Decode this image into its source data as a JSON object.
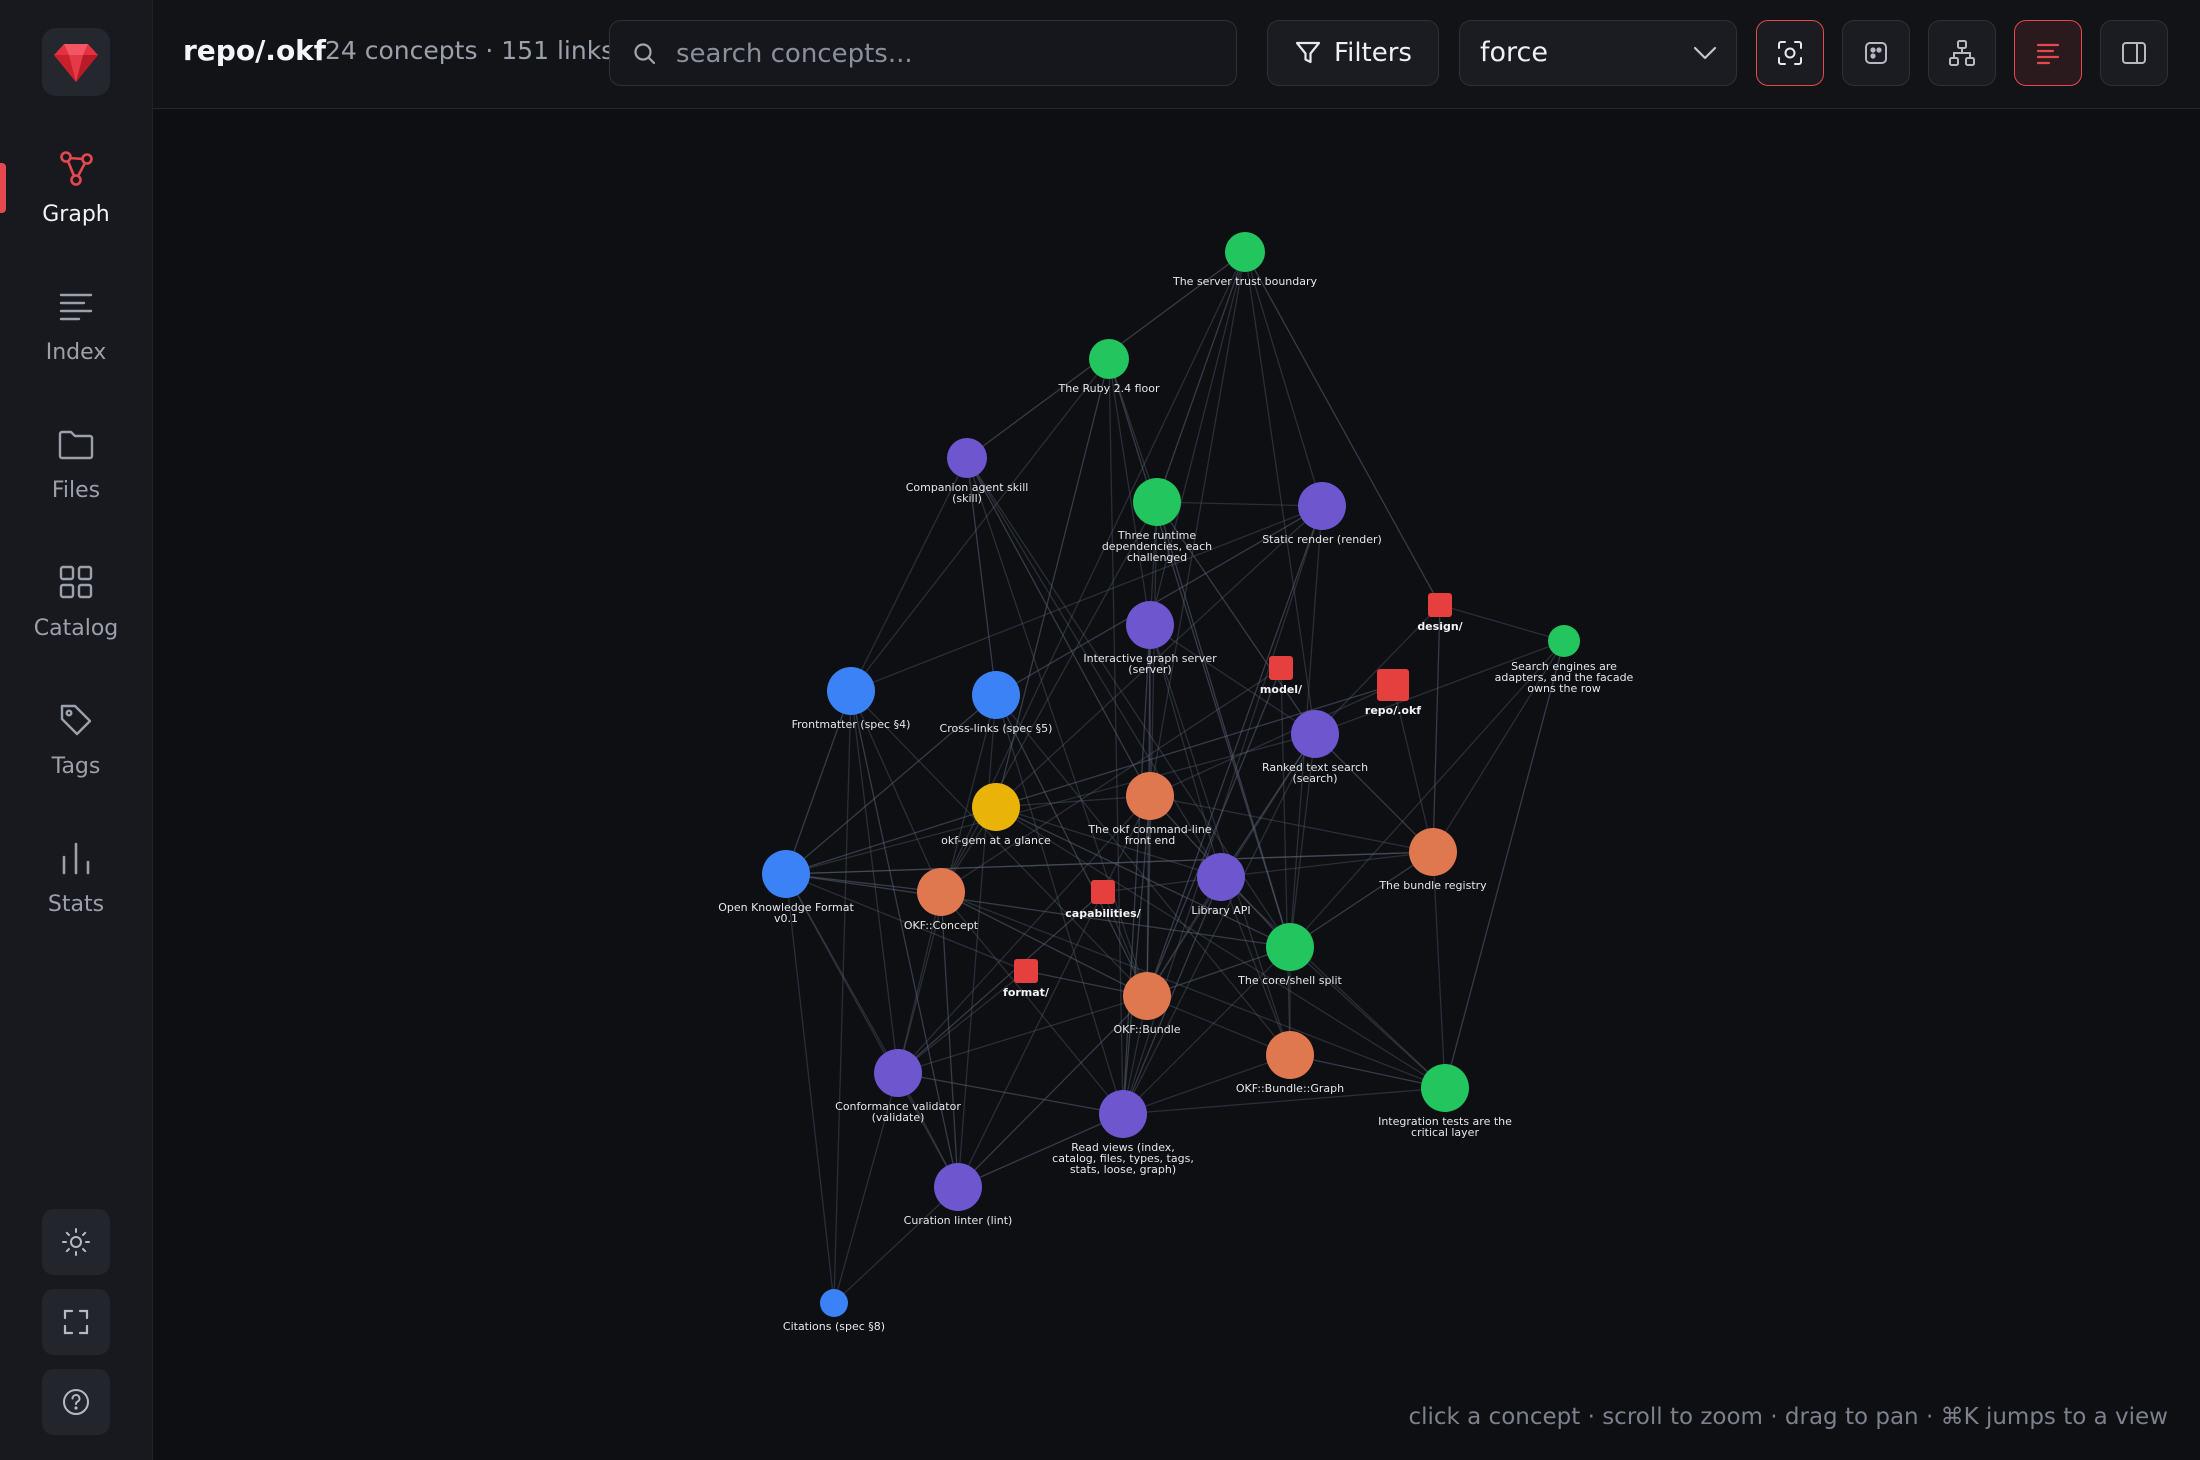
{
  "sidebar": {
    "items": [
      {
        "label": "Graph",
        "icon": "graph-icon",
        "active": true
      },
      {
        "label": "Index",
        "icon": "list-icon"
      },
      {
        "label": "Files",
        "icon": "folder-icon"
      },
      {
        "label": "Catalog",
        "icon": "grid-icon"
      },
      {
        "label": "Tags",
        "icon": "tag-icon"
      },
      {
        "label": "Stats",
        "icon": "bar-chart-icon"
      }
    ],
    "bottom": [
      "sun-icon",
      "fullscreen-icon",
      "help-icon"
    ]
  },
  "header": {
    "title": "repo/.okf",
    "meta": "24 concepts · 151 links",
    "search_placeholder": "search concepts...",
    "filters_label": "Filters",
    "layout_value": "force",
    "toolbar_icons": [
      "focus-icon",
      "cluster-icon",
      "hierarchy-icon",
      "labels-icon",
      "panel-icon"
    ]
  },
  "hint": "click a concept · scroll to zoom · drag to pan · ⌘K jumps to a view",
  "colors": {
    "accent": "#e5484d",
    "blue": "#3b82f6",
    "purple": "#6e56cf",
    "green": "#22c55e",
    "orange": "#e0784f",
    "yellow": "#eab308",
    "red": "#e5403e"
  },
  "graph": {
    "nodes": [
      {
        "id": "server-trust",
        "lines": [
          "The server trust boundary"
        ],
        "color": "green"
      },
      {
        "id": "ruby",
        "lines": [
          "The Ruby 2.4 floor"
        ],
        "color": "green"
      },
      {
        "id": "companion",
        "lines": [
          "Companion agent skill",
          "(skill)"
        ],
        "color": "purple"
      },
      {
        "id": "three-deps",
        "lines": [
          "Three runtime",
          "dependencies, each",
          "challenged"
        ],
        "color": "green"
      },
      {
        "id": "static-render",
        "lines": [
          "Static render (render)"
        ],
        "color": "purple"
      },
      {
        "id": "design",
        "lines": [
          "design/"
        ],
        "color": "red",
        "dir": true
      },
      {
        "id": "search-engines",
        "lines": [
          "Search engines are",
          "adapters, and the facade",
          "owns the row"
        ],
        "color": "green"
      },
      {
        "id": "interactive",
        "lines": [
          "Interactive graph server",
          "(server)"
        ],
        "color": "purple"
      },
      {
        "id": "model",
        "lines": [
          "model/"
        ],
        "color": "red",
        "dir": true
      },
      {
        "id": "repo-okf",
        "lines": [
          "repo/.okf"
        ],
        "color": "red",
        "dir": true
      },
      {
        "id": "frontmatter",
        "lines": [
          "Frontmatter (spec §4)"
        ],
        "color": "blue"
      },
      {
        "id": "crosslinks",
        "lines": [
          "Cross-links (spec §5)"
        ],
        "color": "blue"
      },
      {
        "id": "ranked-search",
        "lines": [
          "Ranked text search",
          "(search)"
        ],
        "color": "purple"
      },
      {
        "id": "okf-gem",
        "lines": [
          "okf-gem at a glance"
        ],
        "color": "yellow"
      },
      {
        "id": "cli",
        "lines": [
          "The okf command-line",
          "front end"
        ],
        "color": "orange"
      },
      {
        "id": "bundle-registry",
        "lines": [
          "The bundle registry"
        ],
        "color": "orange"
      },
      {
        "id": "okf-format",
        "lines": [
          "Open Knowledge Format",
          "v0.1"
        ],
        "color": "blue"
      },
      {
        "id": "okf-concept",
        "lines": [
          "OKF::Concept"
        ],
        "color": "orange"
      },
      {
        "id": "capabilities",
        "lines": [
          "capabilities/"
        ],
        "color": "red",
        "dir": true
      },
      {
        "id": "library-api",
        "lines": [
          "Library API"
        ],
        "color": "purple"
      },
      {
        "id": "core-shell",
        "lines": [
          "The core/shell split"
        ],
        "color": "green"
      },
      {
        "id": "format",
        "lines": [
          "format/"
        ],
        "color": "red",
        "dir": true
      },
      {
        "id": "okf-bundle",
        "lines": [
          "OKF::Bundle"
        ],
        "color": "orange"
      },
      {
        "id": "bundle-graph",
        "lines": [
          "OKF::Bundle::Graph"
        ],
        "color": "orange"
      },
      {
        "id": "conformance",
        "lines": [
          "Conformance validator",
          "(validate)"
        ],
        "color": "purple"
      },
      {
        "id": "integration",
        "lines": [
          "Integration tests are the",
          "critical layer"
        ],
        "color": "green"
      },
      {
        "id": "read-views",
        "lines": [
          "Read views (index,",
          "catalog, files, types, tags,",
          "stats, loose, graph)"
        ],
        "color": "purple"
      },
      {
        "id": "curation",
        "lines": [
          "Curation linter (lint)"
        ],
        "color": "purple"
      },
      {
        "id": "citations",
        "lines": [
          "Citations (spec §8)"
        ],
        "color": "blue"
      }
    ]
  }
}
